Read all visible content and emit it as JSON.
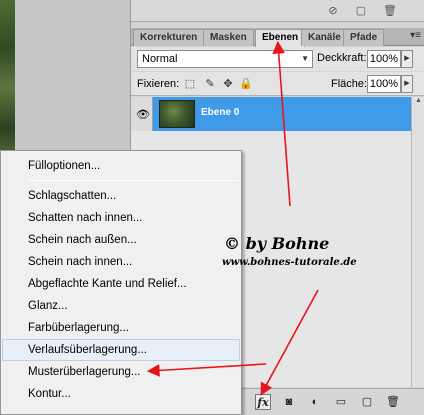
{
  "panel": {
    "tabs": [
      {
        "label": "Korrekturen"
      },
      {
        "label": "Masken"
      },
      {
        "label": "Ebenen"
      },
      {
        "label": "Kanäle"
      },
      {
        "label": "Pfade"
      }
    ],
    "menu_glyph": "▾≡",
    "blend_mode": "Normal",
    "opacity_label": "Deckkraft:",
    "opacity_value": "100%",
    "lock_label": "Fixieren:",
    "fill_label": "Fläche:",
    "fill_value": "100%"
  },
  "layer": {
    "name": "Ebene 0"
  },
  "context_menu": {
    "items": [
      "Fülloptionen...",
      "Schlagschatten...",
      "Schatten nach innen...",
      "Schein nach außen...",
      "Schein nach innen...",
      "Abgeflachte Kante und Relief...",
      "Glanz...",
      "Farbüberlagerung...",
      "Verlaufsüberlagerung...",
      "Musterüberlagerung...",
      "Kontur..."
    ],
    "hovered_index": 8
  },
  "bottom_bar": {
    "fx_label": "fx"
  },
  "watermark": {
    "title": "© by Bohne",
    "url": "www.bohnes-tutorale.de"
  },
  "colors": {
    "selection": "#3f9ae8",
    "arrow": "#e8141c",
    "panel_bg": "#d4d4d4"
  }
}
